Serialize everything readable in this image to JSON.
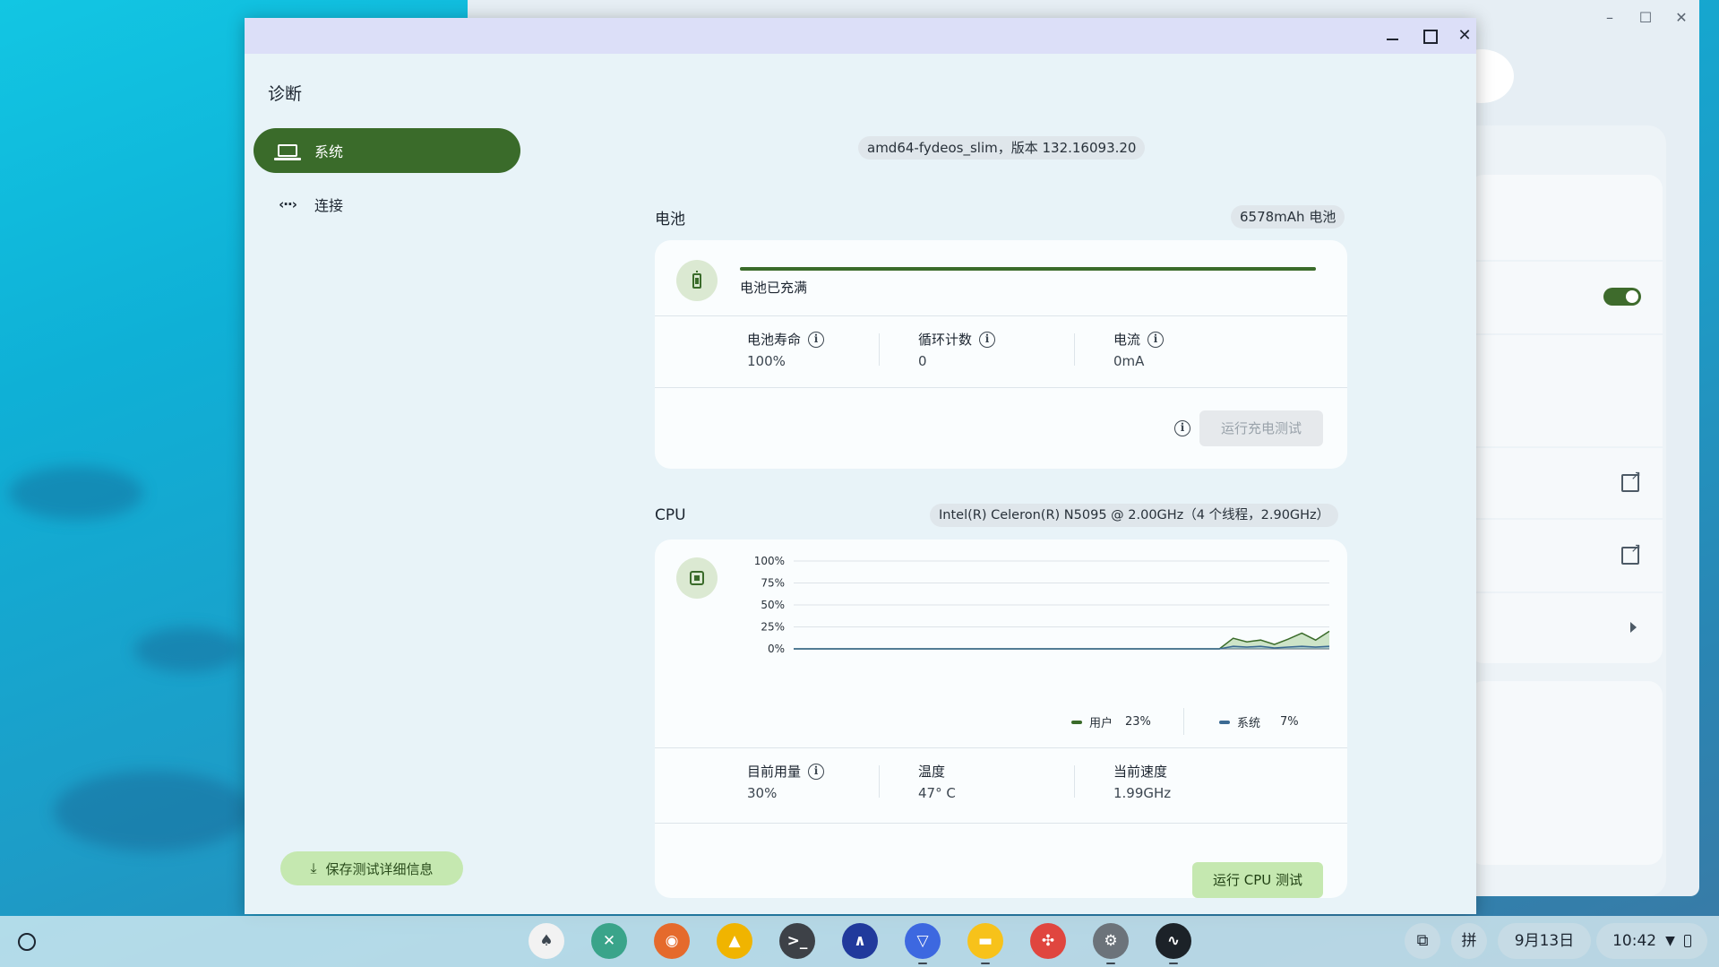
{
  "app": {
    "title": "诊断",
    "window_controls": {
      "minimize": "minimize",
      "maximize": "maximize",
      "close": "✕"
    }
  },
  "sidebar": {
    "items": [
      {
        "label": "系统",
        "icon": "laptop-icon",
        "active": true
      },
      {
        "label": "连接",
        "icon": "connection-icon",
        "active": false
      }
    ],
    "save_button": "保存测试详细信息"
  },
  "system": {
    "version_chip": "amd64-fydeos_slim，版本 132.16093.20"
  },
  "battery": {
    "section_title": "电池",
    "capacity_chip": "6578mAh 电池",
    "status": "电池已充满",
    "charge_fraction": 1.0,
    "stats": [
      {
        "label": "电池寿命",
        "value": "100%"
      },
      {
        "label": "循环计数",
        "value": "0"
      },
      {
        "label": "电流",
        "value": "0mA"
      }
    ],
    "run_button": "运行充电测试"
  },
  "cpu": {
    "section_title": "CPU",
    "model_chip": "Intel(R) Celeron(R) N5095 @ 2.00GHz（4 个线程，2.90GHz）",
    "legend": [
      {
        "label": "用户",
        "value": "23%",
        "color": "#3a6b2a"
      },
      {
        "label": "系统",
        "value": "7%",
        "color": "#3b6a93"
      }
    ],
    "stats": [
      {
        "label": "目前用量",
        "value": "30%"
      },
      {
        "label": "温度",
        "value": "47° C"
      },
      {
        "label": "当前速度",
        "value": "1.99GHz"
      }
    ],
    "run_button": "运行 CPU 测试"
  },
  "chart_data": {
    "type": "area",
    "title": "",
    "xlabel": "",
    "ylabel": "",
    "ylim": [
      0,
      100
    ],
    "yticks": [
      "100%",
      "75%",
      "50%",
      "25%",
      "0%"
    ],
    "grid": true,
    "x": [
      0,
      1,
      2,
      3,
      4,
      5,
      6,
      7,
      8,
      9,
      10,
      11,
      12,
      13,
      14,
      15,
      16,
      17,
      18,
      19,
      20,
      21,
      22,
      23,
      24,
      25,
      26,
      27,
      28,
      29,
      30,
      31,
      32,
      33,
      34,
      35,
      36,
      37,
      38,
      39
    ],
    "series": [
      {
        "name": "用户",
        "values": [
          0,
          0,
          0,
          0,
          0,
          0,
          0,
          0,
          0,
          0,
          0,
          0,
          0,
          0,
          0,
          0,
          0,
          0,
          0,
          0,
          0,
          0,
          0,
          0,
          0,
          0,
          0,
          0,
          0,
          0,
          0,
          0,
          12,
          8,
          10,
          5,
          11,
          18,
          10,
          20
        ]
      },
      {
        "name": "系统",
        "values": [
          0,
          0,
          0,
          0,
          0,
          0,
          0,
          0,
          0,
          0,
          0,
          0,
          0,
          0,
          0,
          0,
          0,
          0,
          0,
          0,
          0,
          0,
          0,
          0,
          0,
          0,
          0,
          0,
          0,
          0,
          0,
          0,
          3,
          2,
          3,
          1,
          2,
          3,
          2,
          3
        ]
      }
    ]
  },
  "shelf": {
    "apps": [
      {
        "name": "app-1-icon",
        "color": "#f2f2f2",
        "glyph": "♠",
        "running": false
      },
      {
        "name": "app-2-icon",
        "color": "#3aa48a",
        "glyph": "✕",
        "running": false
      },
      {
        "name": "app-3-icon",
        "color": "#e56a2c",
        "glyph": "◉",
        "running": false
      },
      {
        "name": "app-4-icon",
        "color": "#f0b400",
        "glyph": "▲",
        "running": false
      },
      {
        "name": "terminal-icon",
        "color": "#3d4147",
        "glyph": ">_",
        "running": false
      },
      {
        "name": "app-6-icon",
        "color": "#213a9c",
        "glyph": "∧",
        "running": false
      },
      {
        "name": "app-7-icon",
        "color": "#3d68e0",
        "glyph": "▽",
        "running": true
      },
      {
        "name": "files-icon",
        "color": "#f7c21a",
        "glyph": "▬",
        "running": true
      },
      {
        "name": "app-9-icon",
        "color": "#e0463f",
        "glyph": "✣",
        "running": false
      },
      {
        "name": "settings-icon",
        "color": "#6c737a",
        "glyph": "⚙",
        "running": true
      },
      {
        "name": "diagnostics-icon",
        "color": "#1c2228",
        "glyph": "∿",
        "running": true
      }
    ],
    "ime": "拼",
    "date": "9月13日",
    "time": "10:42"
  }
}
